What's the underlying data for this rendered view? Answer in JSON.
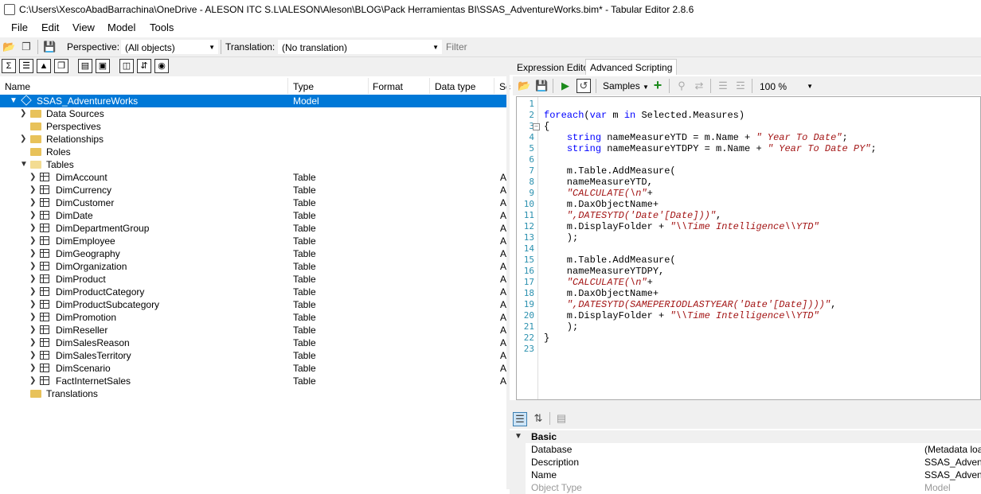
{
  "window": {
    "title": "C:\\Users\\XescoAbadBarrachina\\OneDrive - ALESON ITC S.L\\ALESON\\Aleson\\BLOG\\Pack Herramientas BI\\SSAS_AdventureWorks.bim* - Tabular Editor 2.8.6"
  },
  "menu": [
    "File",
    "Edit",
    "View",
    "Model",
    "Tools"
  ],
  "toolbar": {
    "perspective_label": "Perspective:",
    "perspective_value": "(All objects)",
    "translation_label": "Translation:",
    "translation_value": "(No translation)",
    "filter_placeholder": "Filter"
  },
  "tree": {
    "columns": [
      "Name",
      "Type",
      "Format",
      "Data type",
      "Sc"
    ],
    "model": {
      "name": "SSAS_AdventureWorks",
      "type": "Model"
    },
    "folders": [
      "Data Sources",
      "Perspectives",
      "Relationships",
      "Roles",
      "Tables"
    ],
    "tables": [
      {
        "name": "DimAccount",
        "type": "Table",
        "sc": "A"
      },
      {
        "name": "DimCurrency",
        "type": "Table",
        "sc": "A"
      },
      {
        "name": "DimCustomer",
        "type": "Table",
        "sc": "A"
      },
      {
        "name": "DimDate",
        "type": "Table",
        "sc": "A"
      },
      {
        "name": "DimDepartmentGroup",
        "type": "Table",
        "sc": "A"
      },
      {
        "name": "DimEmployee",
        "type": "Table",
        "sc": "A"
      },
      {
        "name": "DimGeography",
        "type": "Table",
        "sc": "A"
      },
      {
        "name": "DimOrganization",
        "type": "Table",
        "sc": "A"
      },
      {
        "name": "DimProduct",
        "type": "Table",
        "sc": "A"
      },
      {
        "name": "DimProductCategory",
        "type": "Table",
        "sc": "A"
      },
      {
        "name": "DimProductSubcategory",
        "type": "Table",
        "sc": "A"
      },
      {
        "name": "DimPromotion",
        "type": "Table",
        "sc": "A"
      },
      {
        "name": "DimReseller",
        "type": "Table",
        "sc": "A"
      },
      {
        "name": "DimSalesReason",
        "type": "Table",
        "sc": "A"
      },
      {
        "name": "DimSalesTerritory",
        "type": "Table",
        "sc": "A"
      },
      {
        "name": "DimScenario",
        "type": "Table",
        "sc": "A"
      },
      {
        "name": "FactInternetSales",
        "type": "Table",
        "sc": "A"
      }
    ],
    "translations_folder": "Translations"
  },
  "tabs": [
    "Expression Editor",
    "Advanced Scripting"
  ],
  "script_toolbar": {
    "samples_label": "Samples",
    "zoom": "100 %"
  },
  "code_lines": [
    "",
    "foreach(var m in Selected.Measures)",
    "{",
    "    string nameMeasureYTD = m.Name + \" Year To Date\";",
    "    string nameMeasureYTDPY = m.Name + \" Year To Date PY\";",
    "",
    "    m.Table.AddMeasure(",
    "    nameMeasureYTD,",
    "    \"CALCULATE(\\n\"+",
    "    m.DaxObjectName+",
    "    \",DATESYTD('Date'[Date]))\",",
    "    m.DisplayFolder + \"\\\\Time Intelligence\\\\YTD\"",
    "    );",
    "",
    "    m.Table.AddMeasure(",
    "    nameMeasureYTDPY,",
    "    \"CALCULATE(\\n\"+",
    "    m.DaxObjectName+",
    "    \",DATESYTD(SAMEPERIODLASTYEAR('Date'[Date])))\",",
    "    m.DisplayFolder + \"\\\\Time Intelligence\\\\YTD\"",
    "    );",
    "}",
    ""
  ],
  "properties": {
    "category": "Basic",
    "rows": [
      {
        "name": "Database",
        "value": "(Metadata load"
      },
      {
        "name": "Description",
        "value": "SSAS_Adventu"
      },
      {
        "name": "Name",
        "value": "SSAS_Adventu"
      },
      {
        "name": "Object Type",
        "value": "Model"
      }
    ]
  }
}
